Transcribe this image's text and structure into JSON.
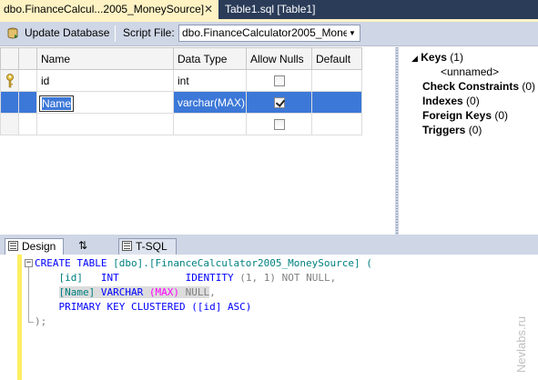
{
  "doc_tabs": {
    "active_label": "dbo.FinanceCalcul...2005_MoneySource]",
    "close_glyph": "✕",
    "inactive_label": "Table1.sql [Table1]"
  },
  "toolbar": {
    "update_label": "Update Database",
    "script_file_label": "Script File:",
    "script_file_value": "dbo.FinanceCalculator2005_Mone"
  },
  "grid": {
    "headers": [
      "Name",
      "Data Type",
      "Allow Nulls",
      "Default"
    ],
    "rows": [
      {
        "name": "id",
        "type": "int",
        "allow_nulls": false,
        "default": "",
        "primary_key": true
      },
      {
        "name": "Name",
        "type": "varchar(MAX)",
        "allow_nulls": true,
        "default": "",
        "selected": true
      },
      {
        "name": "",
        "type": "",
        "allow_nulls": false,
        "default": ""
      }
    ]
  },
  "properties": {
    "keys": "Keys",
    "keys_count": "(1)",
    "key_name": "<unnamed>",
    "check_constraints": "Check Constraints",
    "check_constraints_count": "(0)",
    "indexes": "Indexes",
    "indexes_count": "(0)",
    "foreign_keys": "Foreign Keys",
    "foreign_keys_count": "(0)",
    "triggers": "Triggers",
    "triggers_count": "(0)"
  },
  "bottom_tabs": {
    "design": "Design",
    "swap": "⇅",
    "tsql": "T-SQL"
  },
  "sql": {
    "line1_kw": "CREATE TABLE ",
    "line1_name": "[dbo].[FinanceCalculator2005_MoneySource] (",
    "line2_col": "[id]",
    "line2_type": "INT",
    "line2_identity": "IDENTITY ",
    "line2_args": "(1, 1)",
    "line2_null": " NOT NULL,",
    "line3_col": "[Name]",
    "line3_type": " VARCHAR ",
    "line3_max": "(MAX)",
    "line3_null": " NULL",
    "line3_comma": ",",
    "line4_kw": "PRIMARY KEY CLUSTERED ",
    "line4_args": "([id] ASC)",
    "line5": ");"
  },
  "watermark": "Nevlabs.ru",
  "colors": {
    "tab_bar": "#2b3c59",
    "active_tab": "#fff3c4",
    "toolbar": "#cfd6e5",
    "selection": "#3c78d8",
    "keyword": "#0000ff",
    "margin_indicator": "#ffee62"
  }
}
